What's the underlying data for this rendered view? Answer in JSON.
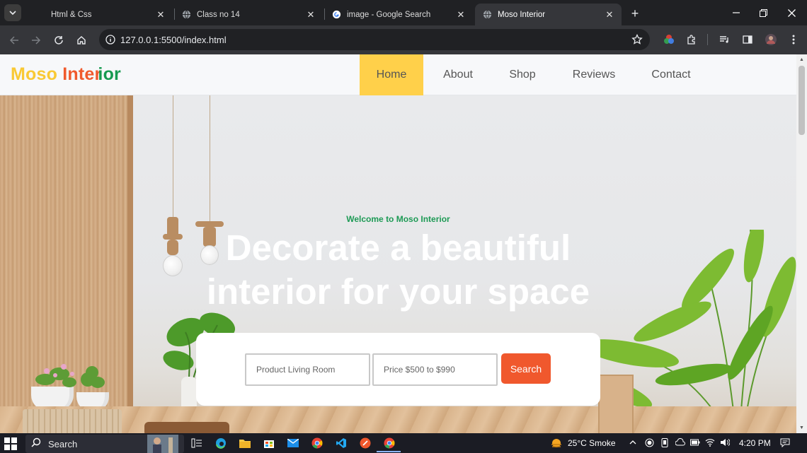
{
  "browser": {
    "tabs": [
      {
        "title": "Html & Css",
        "active": false,
        "icon": "blank-page-icon"
      },
      {
        "title": "Class no 14",
        "active": false,
        "icon": "globe-icon"
      },
      {
        "title": "image - Google Search",
        "active": false,
        "icon": "google-icon"
      },
      {
        "title": "Moso Interior",
        "active": true,
        "icon": "globe-icon"
      }
    ],
    "url": "127.0.0.1:5500/index.html"
  },
  "site": {
    "logo": {
      "part1": "Moso",
      "part2": "Inter",
      "part3": "ior"
    },
    "nav": [
      {
        "label": "Home",
        "active": true
      },
      {
        "label": "About",
        "active": false
      },
      {
        "label": "Shop",
        "active": false
      },
      {
        "label": "Reviews",
        "active": false
      },
      {
        "label": "Contact",
        "active": false
      }
    ],
    "hero": {
      "welcome": "Welcome to Moso Interior",
      "headline_line1": "Decorate a beautiful",
      "headline_line2": "interior for your space"
    },
    "search": {
      "product_placeholder": "Product  Living Room",
      "price_placeholder": "Price $500 to $990",
      "button": "Search"
    }
  },
  "taskbar": {
    "search_label": "Search",
    "weather": "25°C  Smoke",
    "time": "4:20 PM"
  },
  "colors": {
    "logo_yellow": "#f9c935",
    "logo_orange": "#f05a2d",
    "logo_green": "#169a50",
    "nav_active": "#ffd04a",
    "search_button": "#f0582d"
  }
}
